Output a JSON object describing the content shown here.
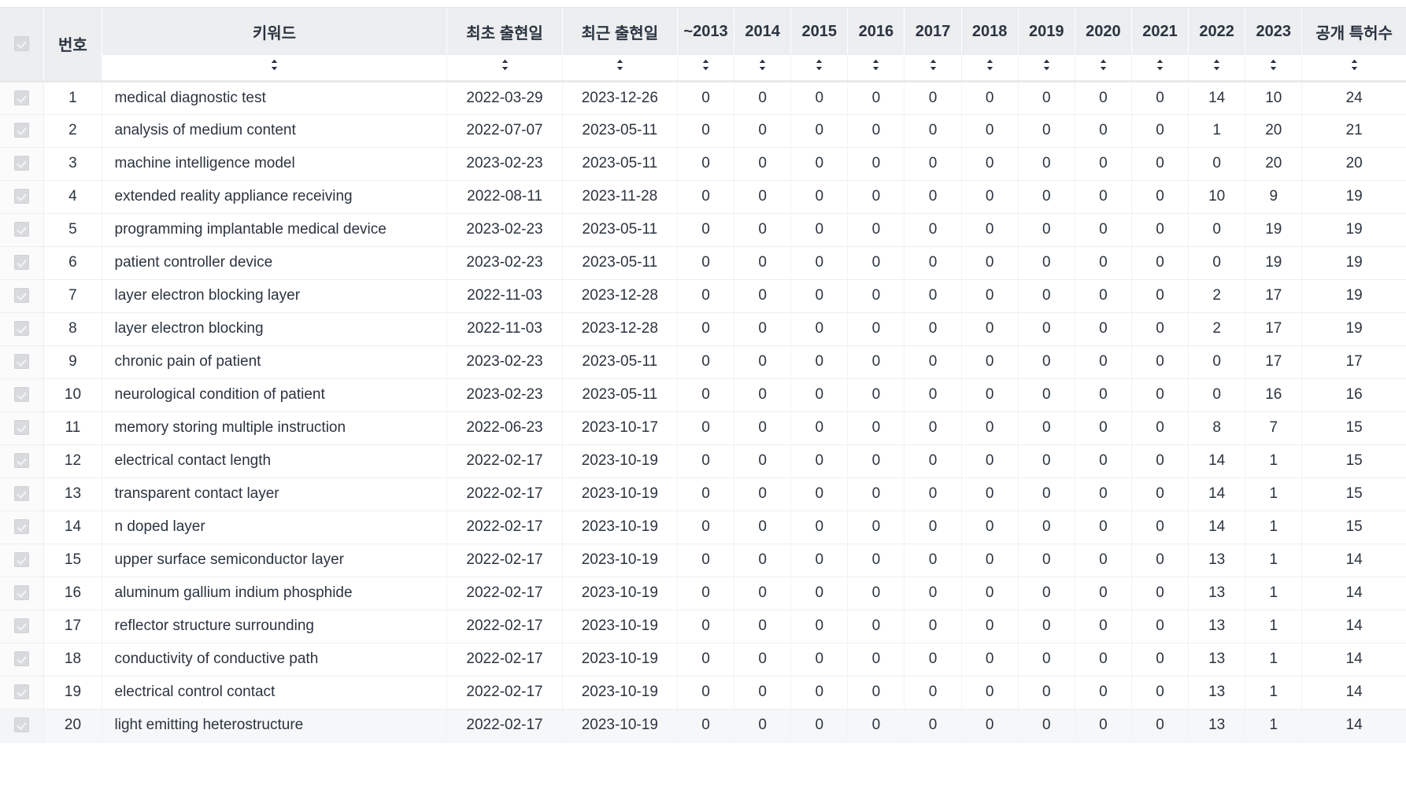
{
  "table": {
    "select_all_checkbox": "select-all",
    "columns": [
      {
        "key": "checkbox",
        "label": "",
        "sortable": false,
        "type": "checkbox"
      },
      {
        "key": "no",
        "label": "번호",
        "sortable": false,
        "type": "index"
      },
      {
        "key": "keyword",
        "label": "키워드",
        "sortable": true,
        "type": "text"
      },
      {
        "key": "first_seen",
        "label": "최초 출현일",
        "sortable": true,
        "type": "date"
      },
      {
        "key": "last_seen",
        "label": "최근 출현일",
        "sortable": true,
        "type": "date"
      },
      {
        "key": "y2013",
        "label": "~2013",
        "sortable": true,
        "type": "number"
      },
      {
        "key": "y2014",
        "label": "2014",
        "sortable": true,
        "type": "number"
      },
      {
        "key": "y2015",
        "label": "2015",
        "sortable": true,
        "type": "number"
      },
      {
        "key": "y2016",
        "label": "2016",
        "sortable": true,
        "type": "number"
      },
      {
        "key": "y2017",
        "label": "2017",
        "sortable": true,
        "type": "number"
      },
      {
        "key": "y2018",
        "label": "2018",
        "sortable": true,
        "type": "number"
      },
      {
        "key": "y2019",
        "label": "2019",
        "sortable": true,
        "type": "number"
      },
      {
        "key": "y2020",
        "label": "2020",
        "sortable": true,
        "type": "number"
      },
      {
        "key": "y2021",
        "label": "2021",
        "sortable": true,
        "type": "number"
      },
      {
        "key": "y2022",
        "label": "2022",
        "sortable": true,
        "type": "number"
      },
      {
        "key": "y2023",
        "label": "2023",
        "sortable": true,
        "type": "number"
      },
      {
        "key": "total",
        "label": "공개 특허수",
        "sortable": true,
        "type": "number"
      }
    ],
    "sort_icon_name": "sort-updown-icon",
    "rows": [
      {
        "no": "1",
        "keyword": "medical diagnostic test",
        "first_seen": "2022-03-29",
        "last_seen": "2023-12-26",
        "years": [
          "0",
          "0",
          "0",
          "0",
          "0",
          "0",
          "0",
          "0",
          "0",
          "14",
          "10"
        ],
        "total": "24",
        "checked": true,
        "highlight": false
      },
      {
        "no": "2",
        "keyword": "analysis of medium content",
        "first_seen": "2022-07-07",
        "last_seen": "2023-05-11",
        "years": [
          "0",
          "0",
          "0",
          "0",
          "0",
          "0",
          "0",
          "0",
          "0",
          "1",
          "20"
        ],
        "total": "21",
        "checked": true,
        "highlight": false
      },
      {
        "no": "3",
        "keyword": "machine intelligence model",
        "first_seen": "2023-02-23",
        "last_seen": "2023-05-11",
        "years": [
          "0",
          "0",
          "0",
          "0",
          "0",
          "0",
          "0",
          "0",
          "0",
          "0",
          "20"
        ],
        "total": "20",
        "checked": true,
        "highlight": false
      },
      {
        "no": "4",
        "keyword": "extended reality appliance receiving",
        "first_seen": "2022-08-11",
        "last_seen": "2023-11-28",
        "years": [
          "0",
          "0",
          "0",
          "0",
          "0",
          "0",
          "0",
          "0",
          "0",
          "10",
          "9"
        ],
        "total": "19",
        "checked": true,
        "highlight": false
      },
      {
        "no": "5",
        "keyword": "programming implantable medical device",
        "first_seen": "2023-02-23",
        "last_seen": "2023-05-11",
        "years": [
          "0",
          "0",
          "0",
          "0",
          "0",
          "0",
          "0",
          "0",
          "0",
          "0",
          "19"
        ],
        "total": "19",
        "checked": true,
        "highlight": false
      },
      {
        "no": "6",
        "keyword": "patient controller device",
        "first_seen": "2023-02-23",
        "last_seen": "2023-05-11",
        "years": [
          "0",
          "0",
          "0",
          "0",
          "0",
          "0",
          "0",
          "0",
          "0",
          "0",
          "19"
        ],
        "total": "19",
        "checked": true,
        "highlight": false
      },
      {
        "no": "7",
        "keyword": "layer electron blocking layer",
        "first_seen": "2022-11-03",
        "last_seen": "2023-12-28",
        "years": [
          "0",
          "0",
          "0",
          "0",
          "0",
          "0",
          "0",
          "0",
          "0",
          "2",
          "17"
        ],
        "total": "19",
        "checked": true,
        "highlight": false
      },
      {
        "no": "8",
        "keyword": "layer electron blocking",
        "first_seen": "2022-11-03",
        "last_seen": "2023-12-28",
        "years": [
          "0",
          "0",
          "0",
          "0",
          "0",
          "0",
          "0",
          "0",
          "0",
          "2",
          "17"
        ],
        "total": "19",
        "checked": true,
        "highlight": false
      },
      {
        "no": "9",
        "keyword": "chronic pain of patient",
        "first_seen": "2023-02-23",
        "last_seen": "2023-05-11",
        "years": [
          "0",
          "0",
          "0",
          "0",
          "0",
          "0",
          "0",
          "0",
          "0",
          "0",
          "17"
        ],
        "total": "17",
        "checked": true,
        "highlight": false
      },
      {
        "no": "10",
        "keyword": "neurological condition of patient",
        "first_seen": "2023-02-23",
        "last_seen": "2023-05-11",
        "years": [
          "0",
          "0",
          "0",
          "0",
          "0",
          "0",
          "0",
          "0",
          "0",
          "0",
          "16"
        ],
        "total": "16",
        "checked": true,
        "highlight": false
      },
      {
        "no": "11",
        "keyword": "memory storing multiple instruction",
        "first_seen": "2022-06-23",
        "last_seen": "2023-10-17",
        "years": [
          "0",
          "0",
          "0",
          "0",
          "0",
          "0",
          "0",
          "0",
          "0",
          "8",
          "7"
        ],
        "total": "15",
        "checked": true,
        "highlight": false
      },
      {
        "no": "12",
        "keyword": "electrical contact length",
        "first_seen": "2022-02-17",
        "last_seen": "2023-10-19",
        "years": [
          "0",
          "0",
          "0",
          "0",
          "0",
          "0",
          "0",
          "0",
          "0",
          "14",
          "1"
        ],
        "total": "15",
        "checked": true,
        "highlight": false
      },
      {
        "no": "13",
        "keyword": "transparent contact layer",
        "first_seen": "2022-02-17",
        "last_seen": "2023-10-19",
        "years": [
          "0",
          "0",
          "0",
          "0",
          "0",
          "0",
          "0",
          "0",
          "0",
          "14",
          "1"
        ],
        "total": "15",
        "checked": true,
        "highlight": false
      },
      {
        "no": "14",
        "keyword": "n doped layer",
        "first_seen": "2022-02-17",
        "last_seen": "2023-10-19",
        "years": [
          "0",
          "0",
          "0",
          "0",
          "0",
          "0",
          "0",
          "0",
          "0",
          "14",
          "1"
        ],
        "total": "15",
        "checked": true,
        "highlight": false
      },
      {
        "no": "15",
        "keyword": "upper surface semiconductor layer",
        "first_seen": "2022-02-17",
        "last_seen": "2023-10-19",
        "years": [
          "0",
          "0",
          "0",
          "0",
          "0",
          "0",
          "0",
          "0",
          "0",
          "13",
          "1"
        ],
        "total": "14",
        "checked": true,
        "highlight": false
      },
      {
        "no": "16",
        "keyword": "aluminum gallium indium phosphide",
        "first_seen": "2022-02-17",
        "last_seen": "2023-10-19",
        "years": [
          "0",
          "0",
          "0",
          "0",
          "0",
          "0",
          "0",
          "0",
          "0",
          "13",
          "1"
        ],
        "total": "14",
        "checked": true,
        "highlight": false
      },
      {
        "no": "17",
        "keyword": "reflector structure surrounding",
        "first_seen": "2022-02-17",
        "last_seen": "2023-10-19",
        "years": [
          "0",
          "0",
          "0",
          "0",
          "0",
          "0",
          "0",
          "0",
          "0",
          "13",
          "1"
        ],
        "total": "14",
        "checked": true,
        "highlight": false
      },
      {
        "no": "18",
        "keyword": "conductivity of conductive path",
        "first_seen": "2022-02-17",
        "last_seen": "2023-10-19",
        "years": [
          "0",
          "0",
          "0",
          "0",
          "0",
          "0",
          "0",
          "0",
          "0",
          "13",
          "1"
        ],
        "total": "14",
        "checked": true,
        "highlight": false
      },
      {
        "no": "19",
        "keyword": "electrical control contact",
        "first_seen": "2022-02-17",
        "last_seen": "2023-10-19",
        "years": [
          "0",
          "0",
          "0",
          "0",
          "0",
          "0",
          "0",
          "0",
          "0",
          "13",
          "1"
        ],
        "total": "14",
        "checked": true,
        "highlight": false
      },
      {
        "no": "20",
        "keyword": "light emitting heterostructure",
        "first_seen": "2022-02-17",
        "last_seen": "2023-10-19",
        "years": [
          "0",
          "0",
          "0",
          "0",
          "0",
          "0",
          "0",
          "0",
          "0",
          "13",
          "1"
        ],
        "total": "14",
        "checked": true,
        "highlight": true
      }
    ]
  },
  "colors": {
    "header_bg": "#eceef0",
    "row_border": "#eceef0",
    "text": "#2b3440",
    "highlight_row_bg": "#f6f7f9",
    "checkbox_bg": "#d8dadd"
  }
}
